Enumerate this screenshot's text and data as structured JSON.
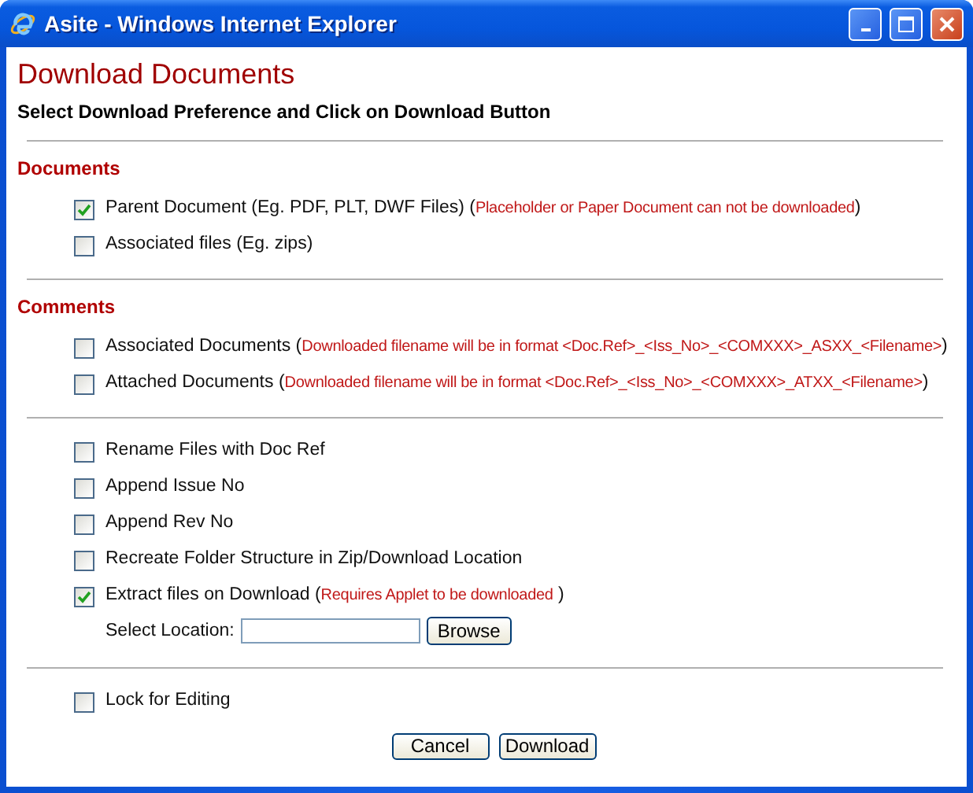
{
  "window": {
    "title": "Asite - Windows Internet Explorer"
  },
  "page": {
    "title": "Download Documents",
    "subtitle": "Select Download Preference and Click on Download Button"
  },
  "sections": [
    {
      "heading": "Documents",
      "options": [
        {
          "label": "Parent Document (Eg. PDF, PLT, DWF Files) (",
          "note": "Placeholder or Paper Document can not be downloaded",
          "tail": ")",
          "checked": true
        },
        {
          "label": "Associated files (Eg. zips)",
          "checked": false
        }
      ]
    },
    {
      "heading": "Comments",
      "options": [
        {
          "label": "Associated Documents (",
          "note": "Downloaded filename will be in format <Doc.Ref>_<Iss_No>_<COMXXX>_ASXX_<Filename>",
          "tail": ")",
          "checked": false
        },
        {
          "label": "Attached Documents (",
          "note": "Downloaded filename will be in format <Doc.Ref>_<Iss_No>_<COMXXX>_ATXX_<Filename>",
          "tail": ")",
          "checked": false
        }
      ]
    },
    {
      "options": [
        {
          "label": "Rename Files with Doc Ref",
          "checked": false
        },
        {
          "label": "Append Issue No",
          "checked": false
        },
        {
          "label": "Append Rev No",
          "checked": false
        },
        {
          "label": "Recreate Folder Structure in Zip/Download Location",
          "checked": false
        },
        {
          "label": "Extract files on Download (",
          "note": "Requires Applet to be downloaded",
          "tail": " )",
          "checked": true
        }
      ],
      "location": {
        "label": "Select Location:",
        "button": "Browse"
      }
    },
    {
      "options": [
        {
          "label": "Lock for Editing",
          "checked": false
        }
      ]
    }
  ],
  "buttons": [
    "Cancel",
    "Download"
  ]
}
